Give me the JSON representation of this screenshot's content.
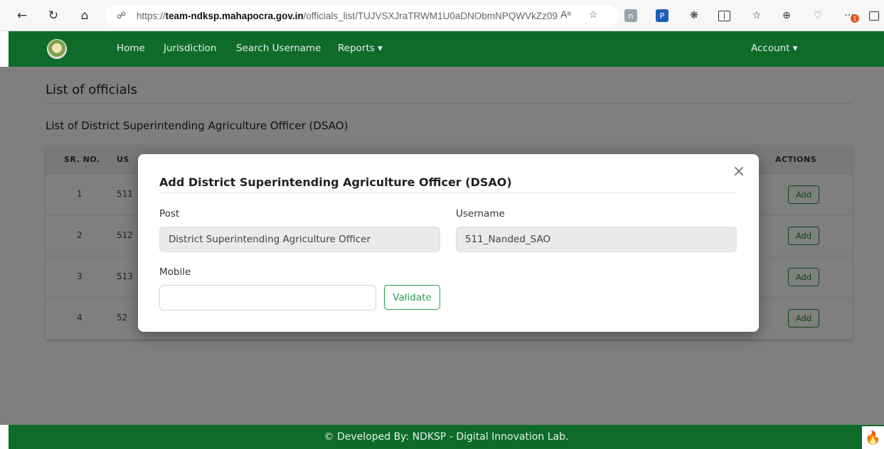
{
  "browser": {
    "url_scheme": "https://",
    "url_host": "team-ndksp.mahapocra.gov.in",
    "url_path": "/officials_list/TUJVSXJraTRWM1U0aDNObmNPQWVkZz09",
    "read_aloud_label": "Aᵃ",
    "notification_badge": "1"
  },
  "navbar": {
    "links": [
      "Home",
      "Jurisdiction",
      "Search Username",
      "Reports ▾"
    ],
    "account": "Account ▾"
  },
  "page": {
    "title": "List of officials",
    "subtitle": "List of District Superintending Agriculture Officer (DSAO)"
  },
  "table": {
    "headers": {
      "sr_no": "SR. NO.",
      "username_partial": "US",
      "actions": "ACTIONS"
    },
    "rows": [
      {
        "sr": "1",
        "username_partial": "511",
        "action": "Add"
      },
      {
        "sr": "2",
        "username_partial": "512",
        "action": "Add"
      },
      {
        "sr": "3",
        "username_partial": "513",
        "action": "Add"
      },
      {
        "sr": "4",
        "username_partial": "52",
        "action": "Add"
      }
    ]
  },
  "modal": {
    "title": "Add District Superintending Agriculture Officer (DSAO)",
    "close_symbol": "×",
    "post_label": "Post",
    "post_value": "District Superintending Agriculture Officer",
    "username_label": "Username",
    "username_value": "511_Nanded_SAO",
    "mobile_label": "Mobile",
    "mobile_value": "",
    "validate_label": "Validate"
  },
  "footer": {
    "text": "© Developed By: NDKSP - Digital Innovation Lab."
  },
  "colors": {
    "brand_green": "#0e6b2a",
    "button_green": "#1f8a3b",
    "backdrop": "rgba(0,0,0,0.5)"
  }
}
